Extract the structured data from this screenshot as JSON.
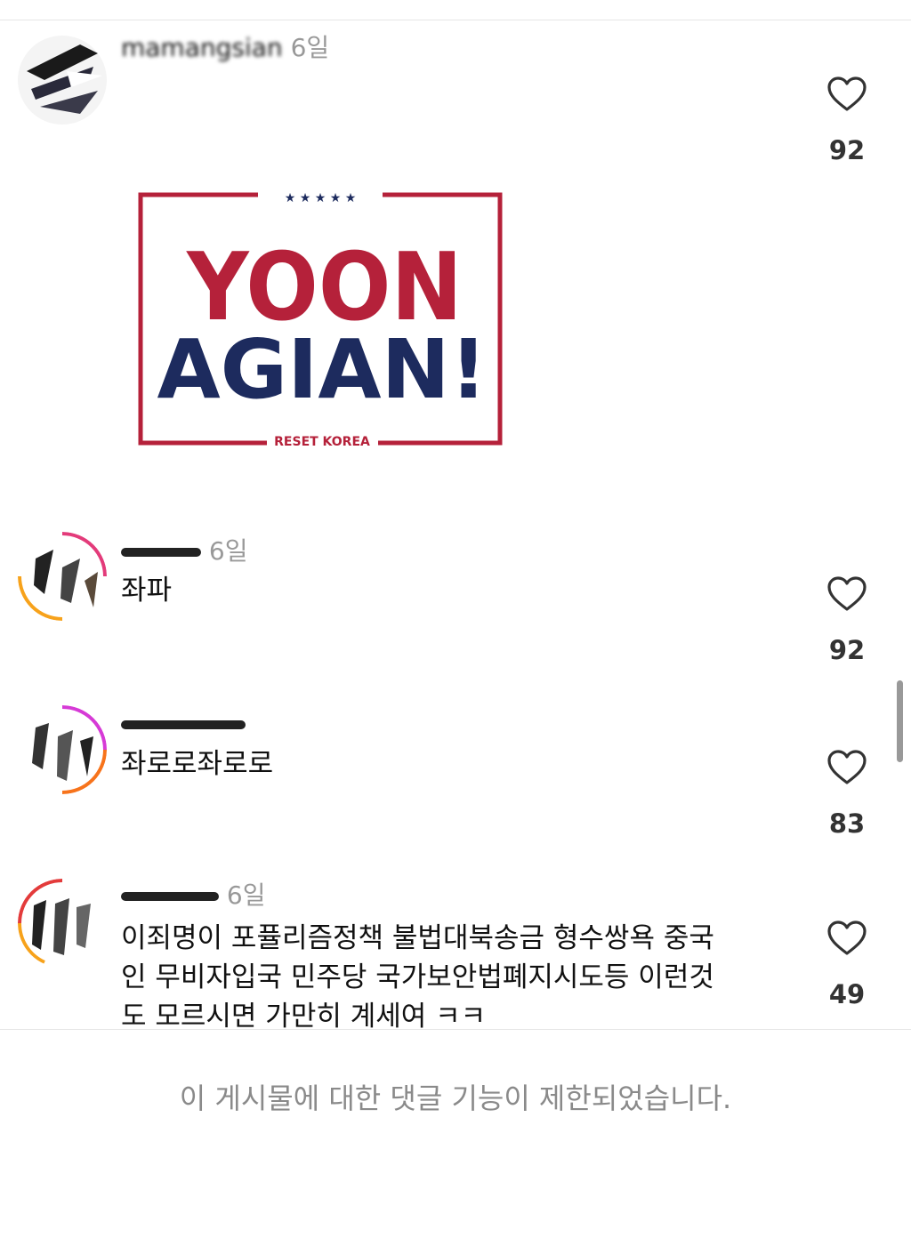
{
  "comments": [
    {
      "username": "mamangsian",
      "time": "6일",
      "text": "",
      "likes": "92",
      "image": {
        "line1": "YOON",
        "line2": "AGIAN!",
        "footer": "RESET KOREA",
        "stars": "★ ★ ★ ★ ★"
      }
    },
    {
      "username": "",
      "time": "6일",
      "text": "좌파",
      "likes": "92"
    },
    {
      "username": "",
      "time": "",
      "text": "좌로로좌로로",
      "likes": "83"
    },
    {
      "username": "",
      "time": "6일",
      "text_lines": [
        "이죄명이 포퓰리즘정책 불법대북송금 형수쌍욕 중국",
        "인 무비자입국 민주당 국가보안법폐지시도등 이런것",
        "도 모르시면 가만히 계세여 ㅋㅋ"
      ],
      "likes": "49"
    }
  ],
  "footer": {
    "restricted_message": "이 게시물에 대한 댓글 기능이 제한되었습니다."
  },
  "colors": {
    "brand_red": "#b5213a",
    "brand_navy": "#1d2b5e",
    "heart_outline": "#333333"
  }
}
